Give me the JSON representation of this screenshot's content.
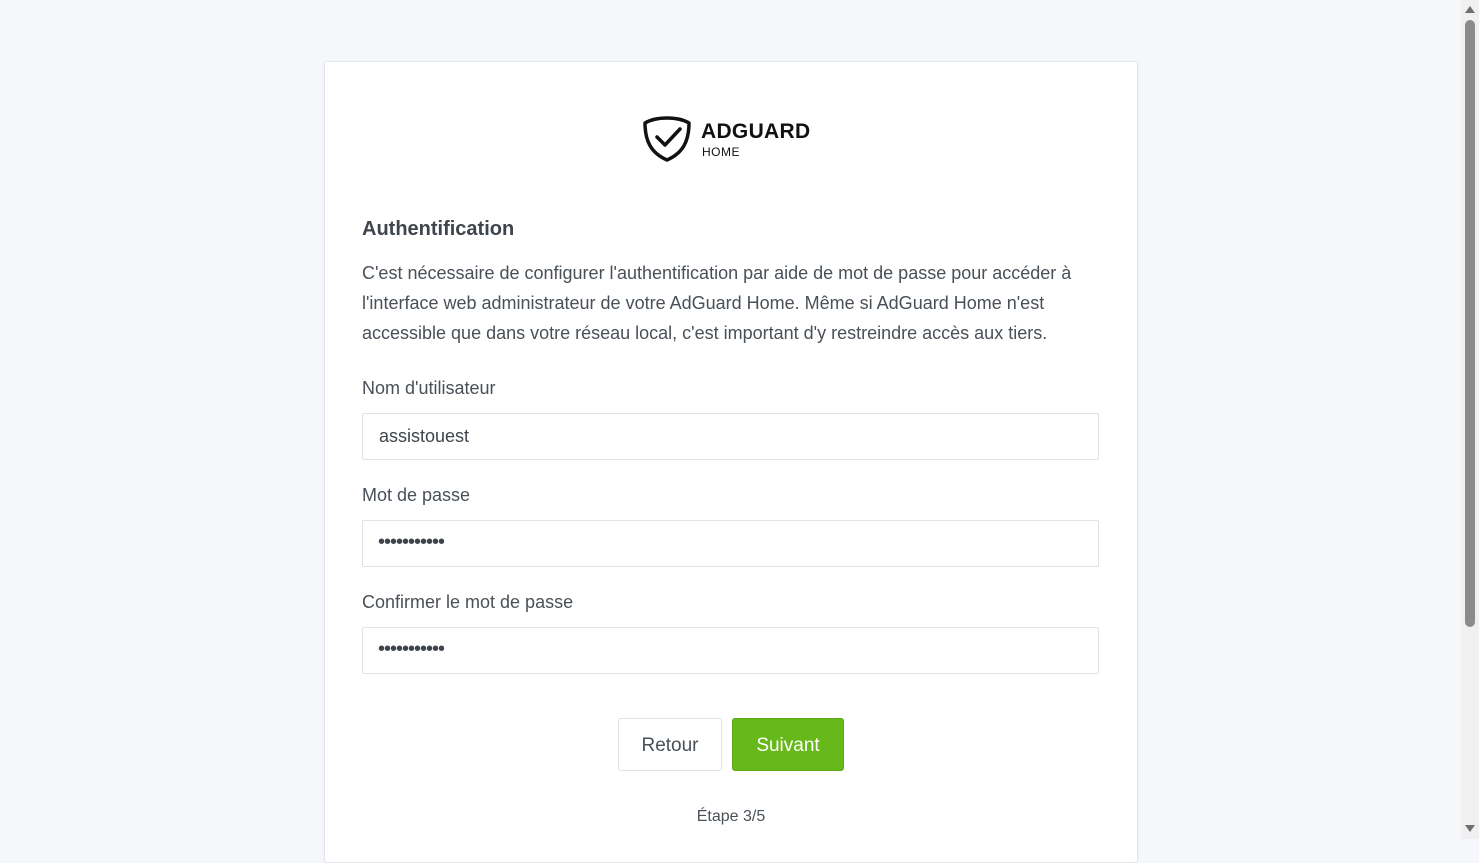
{
  "logo": {
    "brand": "ADGUARD",
    "sub": "HOME"
  },
  "auth": {
    "title": "Authentification",
    "description": "C'est nécessaire de configurer l'authentification par aide de mot de passe pour accéder à l'interface web administrateur de votre AdGuard Home. Même si AdGuard Home n'est accessible que dans votre réseau local, c'est important d'y restreindre accès aux tiers."
  },
  "form": {
    "username_label": "Nom d'utilisateur",
    "username_value": "assistouest",
    "password_label": "Mot de passe",
    "password_value": "•••••••••••",
    "confirm_label": "Confirmer le mot de passe",
    "confirm_value": "•••••••••••"
  },
  "buttons": {
    "back": "Retour",
    "next": "Suivant"
  },
  "step": "Étape 3/5",
  "colors": {
    "accent": "#67b81a",
    "background": "#f5f7fb"
  },
  "icons": {
    "logo": "shield-check-icon"
  }
}
